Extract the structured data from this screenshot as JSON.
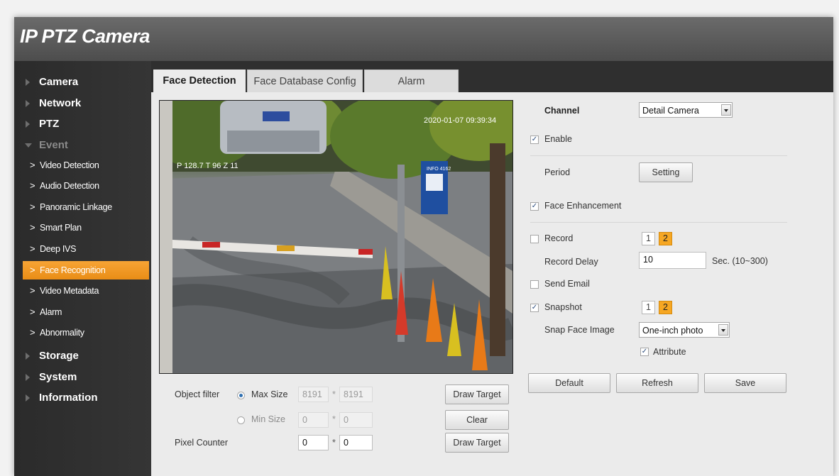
{
  "app": {
    "title": "IP PTZ Camera"
  },
  "sidebar": {
    "top_items": [
      {
        "label": "Camera"
      },
      {
        "label": "Network"
      },
      {
        "label": "PTZ"
      },
      {
        "label": "Event"
      }
    ],
    "event_sub_items": [
      {
        "label": "Video Detection"
      },
      {
        "label": "Audio Detection"
      },
      {
        "label": "Panoramic Linkage"
      },
      {
        "label": "Smart Plan"
      },
      {
        "label": "Deep IVS"
      },
      {
        "label": "Face Recognition"
      },
      {
        "label": "Video Metadata"
      },
      {
        "label": "Alarm"
      },
      {
        "label": "Abnormality"
      }
    ],
    "bottom_items": [
      {
        "label": "Storage"
      },
      {
        "label": "System"
      },
      {
        "label": "Information"
      }
    ],
    "active_item": "Face Recognition"
  },
  "tabs": [
    {
      "label": "Face Detection"
    },
    {
      "label": "Face Database Config"
    },
    {
      "label": "Alarm"
    }
  ],
  "video": {
    "timestamp": "2020-01-07 09:39:34",
    "overlay_text": "P 128.7 T 96 Z 11",
    "sign_text": "INFO 4162"
  },
  "object_filter": {
    "label": "Object filter",
    "max_size_label": "Max Size",
    "max_w": "8191",
    "max_h": "8191",
    "min_size_label": "Min Size",
    "min_w": "0",
    "min_h": "0",
    "selected": "Max Size",
    "times": "*"
  },
  "pixel_counter": {
    "label": "Pixel Counter",
    "w": "0",
    "h": "0"
  },
  "buttons": {
    "draw_target": "Draw Target",
    "clear": "Clear",
    "draw_target_2": "Draw Target",
    "default": "Default",
    "refresh": "Refresh",
    "save": "Save",
    "setting": "Setting"
  },
  "settings": {
    "channel_label": "Channel",
    "channel_value": "Detail Camera",
    "enable_label": "Enable",
    "enable_checked": true,
    "period_label": "Period",
    "face_enhancement_label": "Face Enhancement",
    "face_enhancement_checked": true,
    "record_label": "Record",
    "record_checked": false,
    "record_channels": [
      "1",
      "2"
    ],
    "record_delay_label": "Record Delay",
    "record_delay_value": "10",
    "record_delay_unit": "Sec. (10~300)",
    "send_email_label": "Send Email",
    "send_email_checked": false,
    "snapshot_label": "Snapshot",
    "snapshot_checked": true,
    "snapshot_channels": [
      "1",
      "2"
    ],
    "snap_face_label": "Snap Face Image",
    "snap_face_value": "One-inch photo",
    "attribute_label": "Attribute",
    "attribute_checked": true,
    "check_mark": "✓"
  },
  "colors": {
    "accent": "#f0981f",
    "sidebar_bg": "#2f2f2f",
    "header_bg": "#5a5a5a"
  }
}
